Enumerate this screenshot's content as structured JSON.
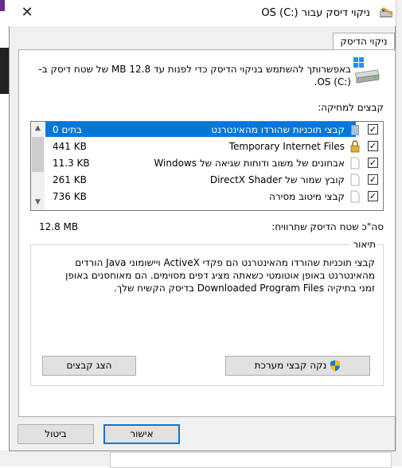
{
  "window": {
    "title": "ניקוי דיסק עבור OS (C:)",
    "close_glyph": "✕",
    "tab_label": "ניקוי הדיסק"
  },
  "intro_text": "באפשרותך להשתמש בניקוי הדיסק כדי לפנות עד 12.8 MB של שטח דיסק ב- OS (C:).",
  "files_label": "קבצים למחיקה:",
  "files": [
    {
      "name": "קבצי תוכניות שהורדו מהאינטרנט",
      "size": "0 בתים",
      "checked": true,
      "selected": true,
      "icon": "folder-icon"
    },
    {
      "name": "Temporary Internet Files",
      "size": "441 KB",
      "checked": true,
      "selected": false,
      "icon": "lock-icon"
    },
    {
      "name": "אבחונים של משוב ודוחות שגיאה של Windows",
      "size": "11.3 KB",
      "checked": true,
      "selected": false,
      "icon": "file-icon"
    },
    {
      "name": "קובץ שמור של DirectX Shader",
      "size": "261 KB",
      "checked": true,
      "selected": false,
      "icon": "file-icon"
    },
    {
      "name": "קבצי מיטוב מסירה",
      "size": "736 KB",
      "checked": true,
      "selected": false,
      "icon": "file-icon"
    }
  ],
  "total_label": "סה\"כ שטח הדיסק שתרוויח:",
  "total_value": "12.8 MB",
  "description": {
    "legend": "תיאור",
    "text": "קבצי תוכניות שהורדו מהאינטרנט הם פקדי ActiveX ויישומוני Java הורדים מהאינטרנט באופן אוטומטי כשאתה מציג דפים מסוימים. הם מאוחסנים באופן זמני בתיקיה Downloaded Program Files בדיסק הקשיח שלך."
  },
  "buttons": {
    "clean_system": "נקה קבצי מערכת",
    "view_files": "הצג קבצים",
    "ok": "אישור",
    "cancel": "ביטול"
  },
  "colors": {
    "selection": "#0078d7",
    "dialog_bg": "#f0f0f0"
  }
}
